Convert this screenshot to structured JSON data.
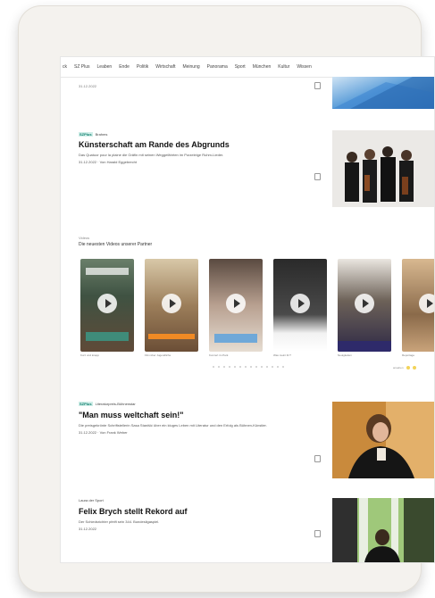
{
  "nav": {
    "items": [
      "ck",
      "SZ Plus",
      "Leaben",
      "Ende",
      "Politik",
      "Wirtschaft",
      "Meinung",
      "Panorama",
      "Sport",
      "München",
      "Kultur",
      "Wissen"
    ]
  },
  "top_item": {
    "date": "31.12.2022"
  },
  "article1": {
    "plus_label": "SZPlus",
    "kicker": "Brahms",
    "title": "Künsterschaft am Rande des Abgrunds",
    "teaser": "Das Quatuor pour la plaine die Gräfin mit seinen Weggefährten im Porzeleige Ruhm-Lieder.",
    "date_author": "31.12.2022 · Von Harald Eggebrecht"
  },
  "videos": {
    "section_label": "Videos",
    "title": "Die neuesten Videos unserer Partner",
    "items": [
      {
        "caption": "Kurz und knapp"
      },
      {
        "caption": "Film über Jugendliche"
      },
      {
        "caption": "Konzert im Park"
      },
      {
        "caption": "Was meint ihr?"
      },
      {
        "caption": "Neuigkeiten"
      },
      {
        "caption": "Reportage"
      }
    ],
    "pager_label": "ansehen"
  },
  "article2": {
    "plus_label": "SZPlus",
    "kicker": "Literaturpreis-Bühnenstar",
    "title": "\"Man muss weltchaft sein!\"",
    "teaser": "Die preisgekrönte Schriftstellerin Sasa Stanišić über ein kluges Leben mit Literatur und den Erfolg als Bühnen-Künstler.",
    "date_author": "31.12.2022 · Von Frank Weber"
  },
  "article3": {
    "kicker": "Laura der Sport",
    "title": "Felix Brych stellt Rekord auf",
    "teaser": "Der Schiedsrichter pfeift sein 344. Bundesligaspiel.",
    "date": "31.12.2022"
  },
  "colors": {
    "plus_bg": "#cfeee8",
    "plus_text": "#127f6f",
    "accent_orange": "#f08a24"
  }
}
